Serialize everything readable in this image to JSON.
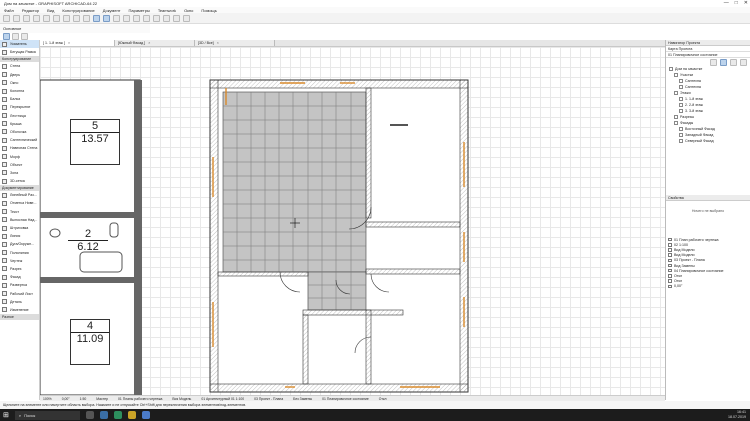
{
  "window": {
    "title": "Дом на зачастке - GRAPHISOFT ARCHICAD-64 22",
    "controls": [
      "—",
      "□",
      "✕"
    ]
  },
  "menu": [
    "Файл",
    "Редактор",
    "Вид",
    "Конструирование",
    "Документ",
    "Параметры",
    "Teamwork",
    "Окно",
    "Помощь"
  ],
  "toolbar2": {
    "label": "Основное"
  },
  "tabs": [
    {
      "label": "[ 1. 1-й этаж ]",
      "active": true
    },
    {
      "label": "[Южный Фасад ]",
      "active": false
    },
    {
      "label": "[3D / Все]",
      "active": false
    }
  ],
  "toolbox": {
    "top": [
      "Указатель",
      "Бегущая Рамка"
    ],
    "group_design": "Конструирование",
    "design": [
      "Стена",
      "Дверь",
      "Окно",
      "Колонна",
      "Балка",
      "Перекрытие",
      "Лестница",
      "Крыша",
      "Оболочка",
      "Сантехнический",
      "Навесная Стена",
      "Морф",
      "Объект",
      "Зона",
      "3D-сетка"
    ],
    "group_doc": "Документирование",
    "doc": [
      "Линейный Раз...",
      "Отметка Ниве...",
      "Текст",
      "Выносная Над...",
      "Штриховка",
      "Линия",
      "Дуга/Окружн...",
      "Полилиния",
      "Чертеж",
      "Разрез",
      "Фасад",
      "Развертка",
      "Рабочий Лист",
      "Деталь",
      "Изменение"
    ],
    "group_more": "Разное"
  },
  "rooms": [
    {
      "number": "5",
      "area": "13.57"
    },
    {
      "number": "2",
      "area": "6.12"
    },
    {
      "number": "4",
      "area": "11.09"
    }
  ],
  "statusbar": [
    "100%",
    "0,00°",
    "1:50",
    "Мастер",
    "01 Планы рабочего чертежа",
    "Вся Модель",
    "01 Архитектурный 01 1:100",
    "03 Проект - Плана",
    "Без Замены",
    "01 Планировочное состояние",
    "Откл"
  ],
  "hint": "Щелкните на элементе или начертите область выбора. Нажмите и не отпускайте Ctrl+Shift для переключения выбора элементов/под-элементов.",
  "taskbar": {
    "search": "Поиск",
    "time": "16:41",
    "date": "18.07.2019"
  },
  "navigator": {
    "title": "Навигатор Проекта",
    "combo": "Карта Проекта",
    "combo2": "01 Планировочное состояние",
    "tree": [
      {
        "label": "Дом на зачастке",
        "depth": 0
      },
      {
        "label": "Участки",
        "depth": 1
      },
      {
        "label": "Сантехна",
        "depth": 2
      },
      {
        "label": "Сантехна",
        "depth": 2
      },
      {
        "label": "Этажи",
        "depth": 1
      },
      {
        "label": "1. 1-й этаж",
        "depth": 2
      },
      {
        "label": "2. 2-й этаж",
        "depth": 2
      },
      {
        "label": "3. 3-й этаж",
        "depth": 2
      },
      {
        "label": "Разрезы",
        "depth": 1
      },
      {
        "label": "Фасады",
        "depth": 1
      },
      {
        "label": "Восточный Фасад",
        "depth": 2
      },
      {
        "label": "Западный Фасад",
        "depth": 2
      },
      {
        "label": "Северный Фасад",
        "depth": 2
      }
    ]
  },
  "properties": {
    "title": "Свойства",
    "empty": "Ничего не выбрано"
  },
  "views": [
    "01 План рабочего чертежа",
    "02 1:100",
    "Вид Модели",
    "Вид Модели",
    "03 Проект - Плана",
    "Вид Замены",
    "04 Планировочное состояние",
    "Откл",
    "Откл",
    "0,00°"
  ]
}
